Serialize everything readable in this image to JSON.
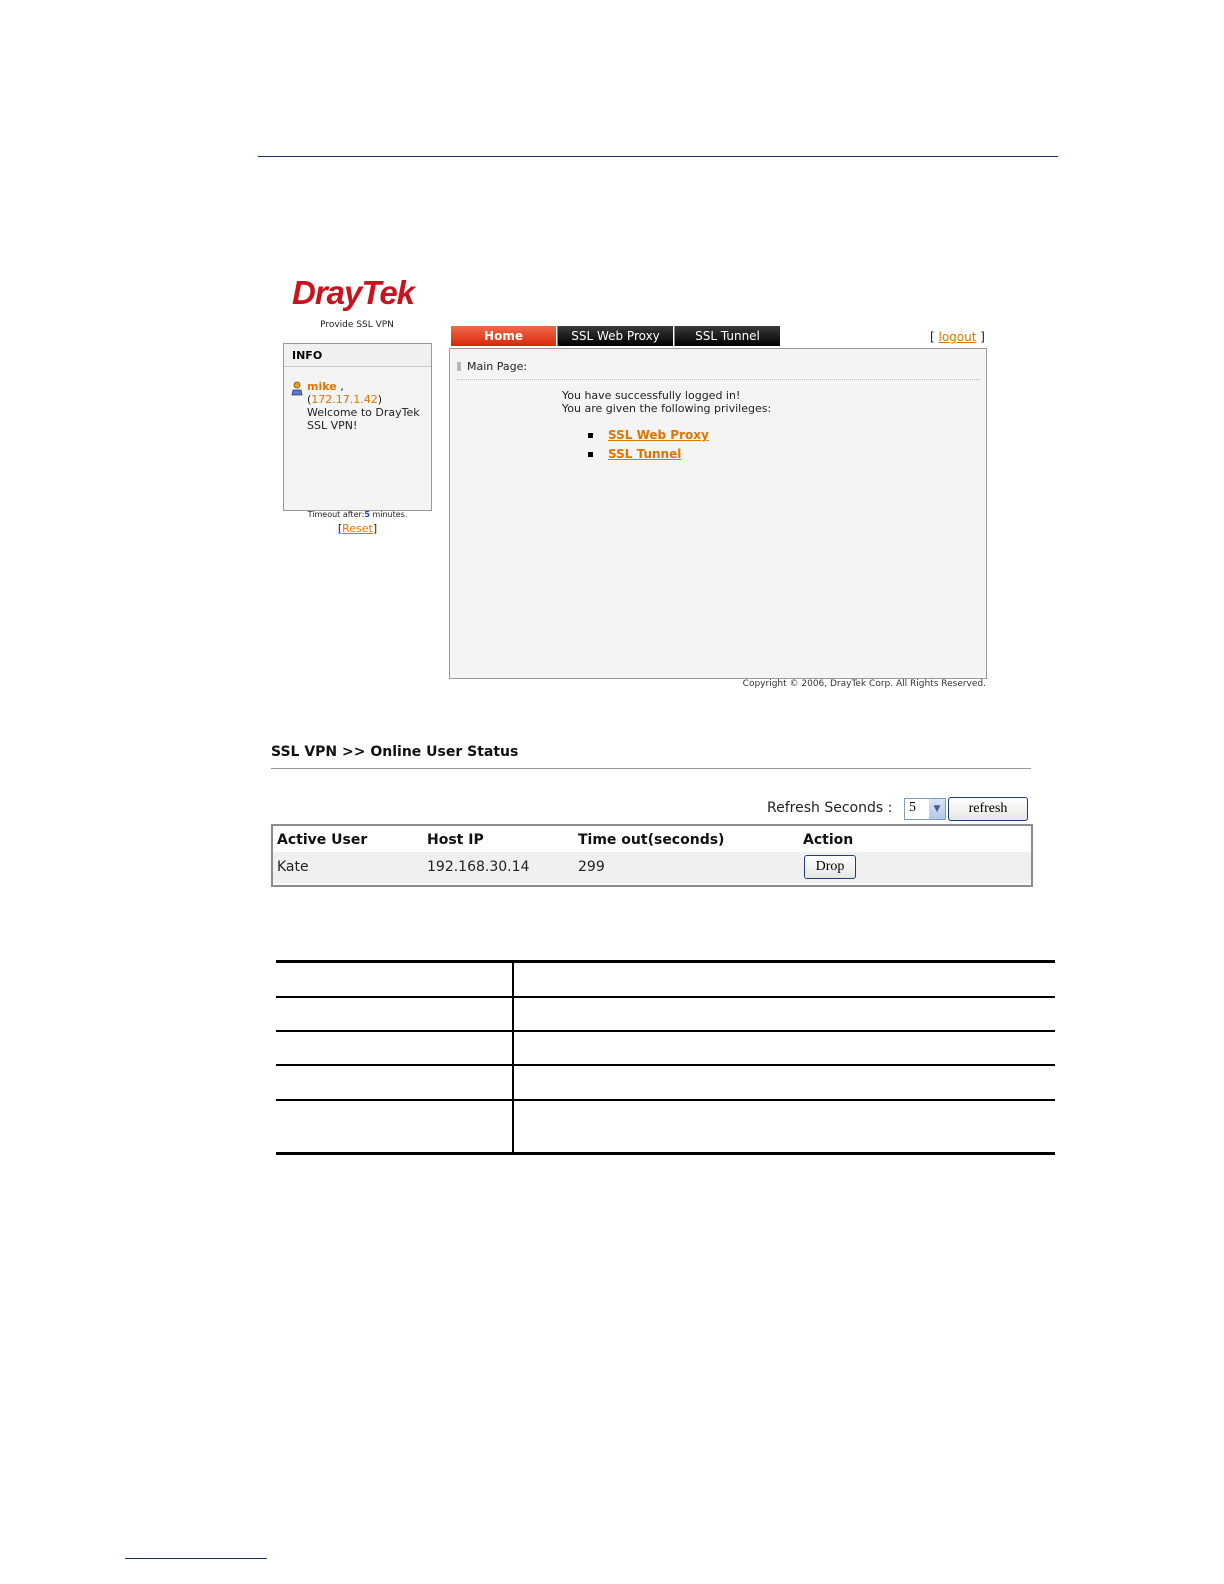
{
  "portal": {
    "logo": "DrayTek",
    "tagline": "Provide SSL VPN",
    "info": {
      "title": "INFO",
      "username": "mike",
      "ip": "172.17.1.42",
      "welcome_line1": "Welcome to DrayTek",
      "welcome_line2": "SSL VPN!"
    },
    "timeout_prefix": "Timeout after:",
    "timeout_value": "5",
    "timeout_suffix": " minutes.",
    "reset_label": "Reset",
    "tabs": [
      "Home",
      "SSL Web Proxy",
      "SSL Tunnel"
    ],
    "logout_label": "logout",
    "main": {
      "label": "Main Page:",
      "msg1": "You have successfully logged in!",
      "msg2": "You are given the following privileges:",
      "privileges": [
        "SSL Web Proxy",
        "SSL Tunnel"
      ]
    },
    "copyright": "Copyright © 2006, DrayTek Corp. All Rights Reserved.",
    "colors": {
      "accent": "#e07400",
      "brand": "#c8141e",
      "tab_active": "#d8280c"
    }
  },
  "online_status": {
    "title": "SSL VPN >> Online User Status",
    "refresh_label": "Refresh Seconds :",
    "refresh_value": "5",
    "refresh_button": "refresh",
    "columns": [
      "Active User",
      "Host IP",
      "Time out(seconds)",
      "Action"
    ],
    "rows": [
      {
        "user": "Kate",
        "ip": "192.168.30.14",
        "timeout": "299",
        "action": "Drop"
      }
    ]
  }
}
